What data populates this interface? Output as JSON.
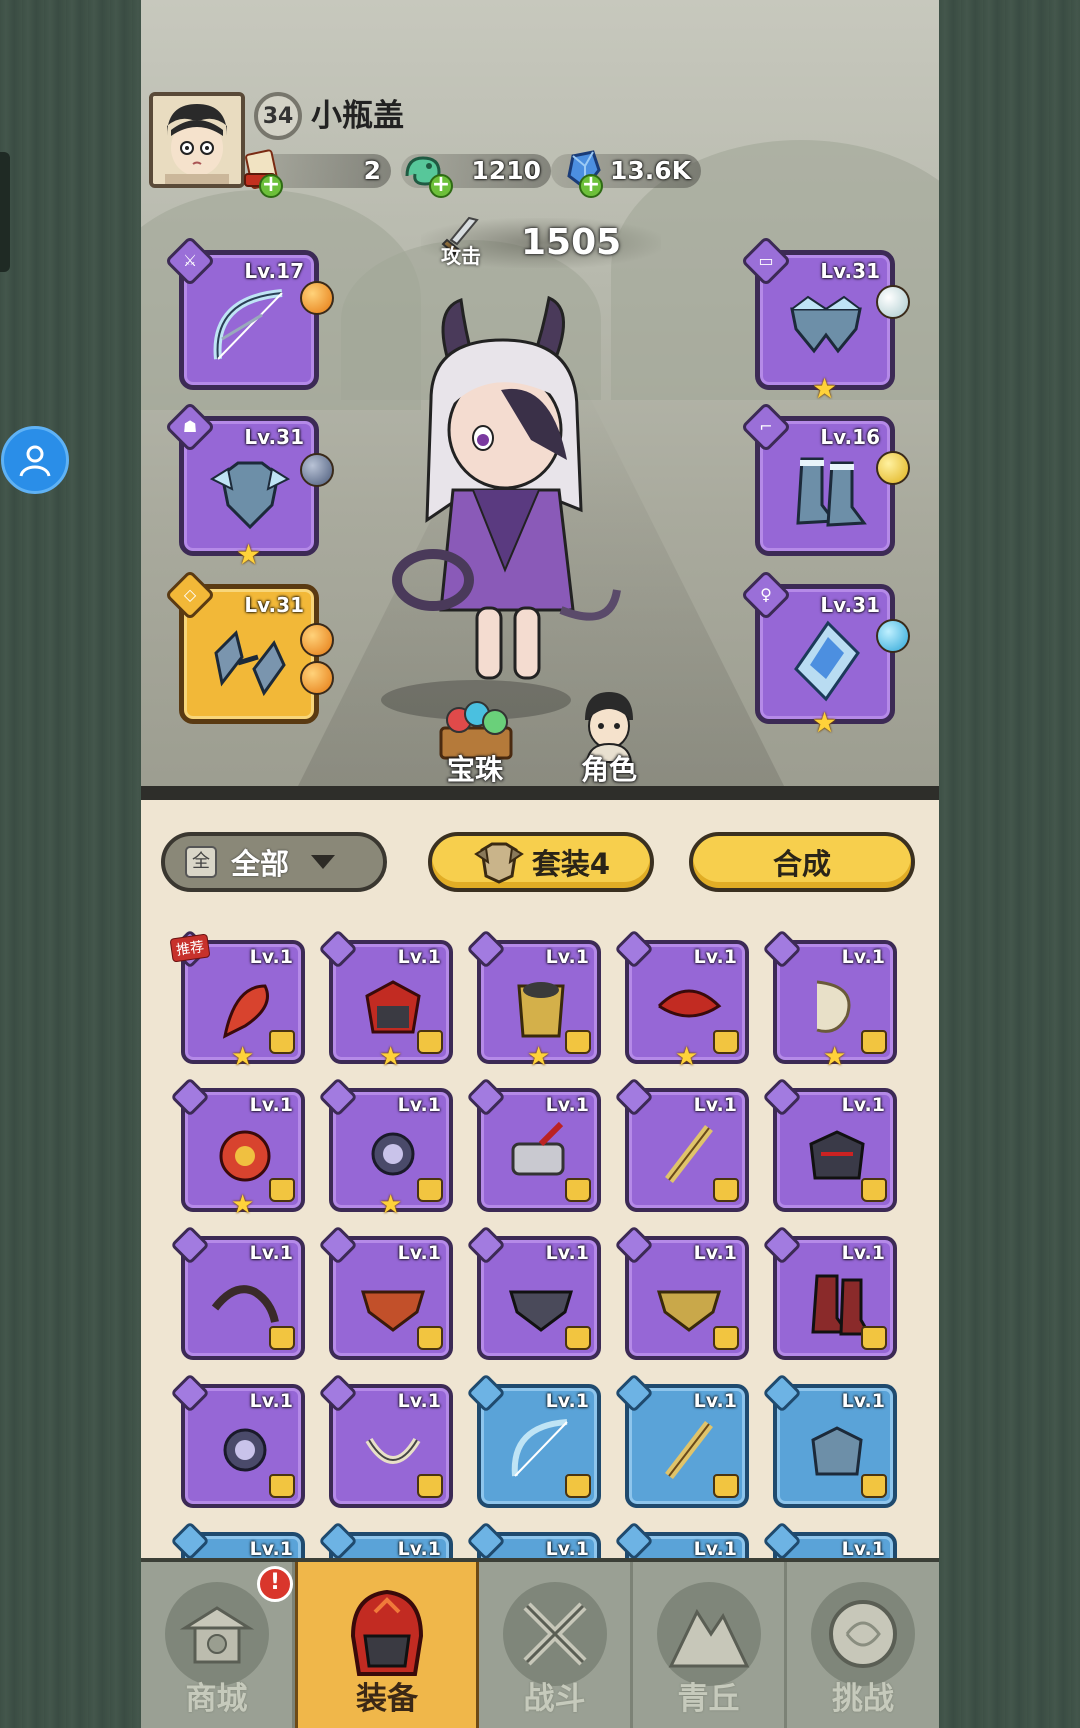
{
  "player": {
    "name": "小瓶盖",
    "level": "34"
  },
  "resources": [
    {
      "name": "order-token",
      "value": "2"
    },
    {
      "name": "jade-dragon",
      "value": "1210"
    },
    {
      "name": "crystal",
      "value": "13.6K"
    }
  ],
  "attack": {
    "label": "攻击",
    "value": "1505"
  },
  "equipped": {
    "weapon": {
      "level": "Lv.17",
      "rarity": "purple"
    },
    "armor": {
      "level": "Lv.31",
      "rarity": "purple",
      "stars": 1
    },
    "ring": {
      "level": "Lv.31",
      "rarity": "gold"
    },
    "pants": {
      "level": "Lv.31",
      "rarity": "purple",
      "stars": 1
    },
    "boots": {
      "level": "Lv.16",
      "rarity": "purple"
    },
    "amulet": {
      "level": "Lv.31",
      "rarity": "purple",
      "stars": 1
    }
  },
  "hero_buttons": {
    "gems": "宝珠",
    "role": "角色"
  },
  "filters": {
    "all_label": "全部",
    "all_icon": "全",
    "set_label": "套装4",
    "merge_label": "合成"
  },
  "recommend_tag": "推荐",
  "inventory": [
    {
      "level": "Lv.1",
      "color": "purple",
      "star": true
    },
    {
      "level": "Lv.1",
      "color": "purple",
      "star": true
    },
    {
      "level": "Lv.1",
      "color": "purple",
      "star": true
    },
    {
      "level": "Lv.1",
      "color": "purple",
      "star": true
    },
    {
      "level": "Lv.1",
      "color": "purple",
      "star": true
    },
    {
      "level": "Lv.1",
      "color": "purple",
      "star": true
    },
    {
      "level": "Lv.1",
      "color": "purple",
      "star": true
    },
    {
      "level": "Lv.1",
      "color": "purple",
      "star": false
    },
    {
      "level": "Lv.1",
      "color": "purple",
      "star": false
    },
    {
      "level": "Lv.1",
      "color": "purple",
      "star": false
    },
    {
      "level": "Lv.1",
      "color": "purple",
      "star": false
    },
    {
      "level": "Lv.1",
      "color": "purple",
      "star": false
    },
    {
      "level": "Lv.1",
      "color": "purple",
      "star": false
    },
    {
      "level": "Lv.1",
      "color": "purple",
      "star": false
    },
    {
      "level": "Lv.1",
      "color": "purple",
      "star": false
    },
    {
      "level": "Lv.1",
      "color": "purple",
      "star": false
    },
    {
      "level": "Lv.1",
      "color": "purple",
      "star": false
    },
    {
      "level": "Lv.1",
      "color": "blue",
      "star": false
    },
    {
      "level": "Lv.1",
      "color": "blue",
      "star": false
    },
    {
      "level": "Lv.1",
      "color": "blue",
      "star": false
    },
    {
      "level": "Lv.1",
      "color": "blue",
      "star": false
    },
    {
      "level": "Lv.1",
      "color": "blue",
      "star": false
    },
    {
      "level": "Lv.1",
      "color": "blue",
      "star": false
    },
    {
      "level": "Lv.1",
      "color": "blue",
      "star": false
    },
    {
      "level": "Lv.1",
      "color": "blue",
      "star": false
    }
  ],
  "nav": [
    {
      "label": "商城",
      "notification": "!"
    },
    {
      "label": "装备"
    },
    {
      "label": "战斗"
    },
    {
      "label": "青丘"
    },
    {
      "label": "挑战"
    }
  ],
  "colors": {
    "purple": "#9667d6",
    "blue": "#5aa3d8",
    "gold": "#f2b838",
    "active_tab": "#f0b74a"
  }
}
